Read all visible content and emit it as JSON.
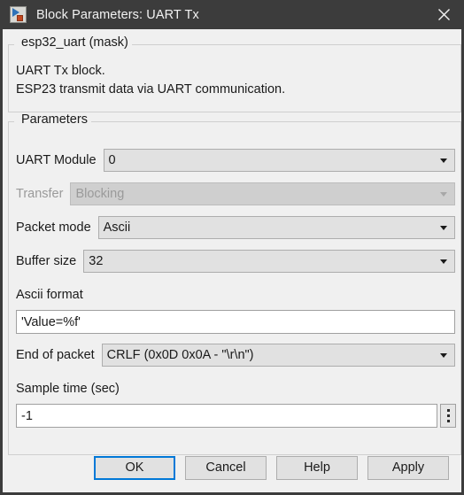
{
  "window": {
    "title": "Block Parameters: UART Tx",
    "icon": "simulink-block-icon",
    "close_label": "close-icon",
    "titlebar_color": "#3c3c3c",
    "accent_color": "#0078d7",
    "background_color": "#f0f0f0"
  },
  "description": {
    "legend": "esp32_uart (mask)",
    "line1": "UART Tx block.",
    "line2": "ESP23 transmit data via UART communication."
  },
  "parameters": {
    "legend": "Parameters",
    "fields": [
      {
        "label": "UART Module",
        "type": "combobox",
        "value": "0",
        "enabled": true
      },
      {
        "label": "Transfer",
        "type": "combobox",
        "value": "Blocking",
        "enabled": false
      },
      {
        "label": "Packet mode",
        "type": "combobox",
        "value": "Ascii",
        "enabled": true
      },
      {
        "label": "Buffer size",
        "type": "combobox",
        "value": "32",
        "enabled": true
      },
      {
        "label": "Ascii format",
        "type": "textfield",
        "value": "'Value=%f'",
        "enabled": true
      },
      {
        "label": "End of packet",
        "type": "combobox",
        "value": "CRLF (0x0D 0x0A - \"\\r\\n\")",
        "enabled": true
      },
      {
        "label": "Sample time (sec)",
        "type": "textfield",
        "value": "-1",
        "enabled": true,
        "has_dots_button": true
      }
    ]
  },
  "footer": {
    "ok_label": "OK",
    "cancel_label": "Cancel",
    "help_label": "Help",
    "apply_label": "Apply"
  }
}
